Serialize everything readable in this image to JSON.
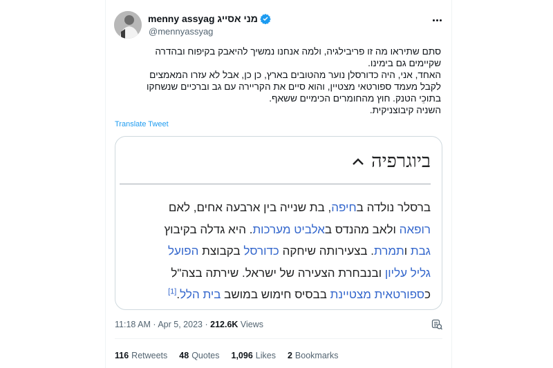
{
  "author": {
    "display_name": "menny assyag מני אסייג",
    "handle": "@mennyassyag"
  },
  "tweet": {
    "lines": [
      "סתם שתיראו מה זו פריבילגיה, ולמה אנחנו נמשיך להיאבק בקיפוח ובהדרה",
      "שקיימים גם בימינו.",
      "האחד, אני, היה כדורסלן נוער מהטובים בארץ, כן כן, אבל לא עזרו המאמצים",
      "לקבל מעמד ספורטאי מצטיין, והוא סיים את הקריירה עם גב וברכיים שנשחקו",
      "בתוכֵי הטנק. חוץ מהחומרים הכימיים ששאף.",
      "השניה קיבוצניקית."
    ],
    "translate_label": "Translate Tweet"
  },
  "wiki": {
    "heading": "ביוגרפיה",
    "line1": {
      "a": "ברסלר נולדה ב",
      "link1": "חיפה",
      "b": ", בת שנייה בין ארבעה אחים, לאם"
    },
    "line2": {
      "link1": "רופאה",
      "a": " ולאב מהנדס ב",
      "link2": "אלביט מערכות",
      "b": ". היא גדלה בקיבוץ"
    },
    "line3": {
      "link1": "גבת",
      "a": " ו",
      "link2": "תמרת",
      "b": ". בצעירותה שיחקה ",
      "link3": "כדורסל",
      "c": " בקבוצת ",
      "link4": "הפועל"
    },
    "line4": {
      "link1": "גליל עליון",
      "a": " ובנבחרת הצעירה של ישראל. שירתה בצה\"ל"
    },
    "line5": {
      "a": "כ",
      "link1": "ספורטאית מצטיינת",
      "b": " בבסיס חימוש במושב ",
      "link2": "בית הלל",
      "c": ".",
      "ref": "[1]"
    }
  },
  "meta": {
    "time": "11:18 AM",
    "separator": "·",
    "date": "Apr 5, 2023",
    "views_count": "212.6K",
    "views_label": "Views"
  },
  "stats": {
    "retweets_count": "116",
    "retweets_label": "Retweets",
    "quotes_count": "48",
    "quotes_label": "Quotes",
    "likes_count": "1,096",
    "likes_label": "Likes",
    "bookmarks_count": "2",
    "bookmarks_label": "Bookmarks"
  },
  "colors": {
    "link": "#1d9bf0",
    "wiki_link": "#3366cc",
    "verified": "#1d9bf0",
    "secondary_text": "#536471"
  },
  "icons": [
    "verified-badge-icon",
    "more-options-icon",
    "view-analytics-icon",
    "collapse-chevron-icon"
  ]
}
